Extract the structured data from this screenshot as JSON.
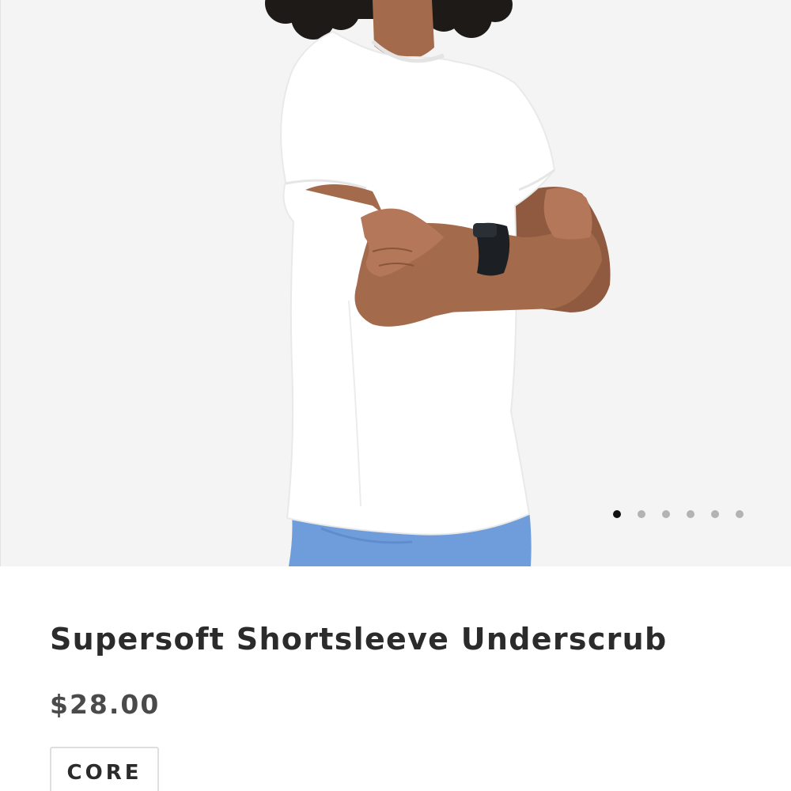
{
  "product": {
    "title": "Supersoft Shortsleeve Underscrub",
    "price": "$28.00",
    "tag": "CORE"
  },
  "gallery": {
    "image_count": 6,
    "active_index": 0
  },
  "colors": {
    "background": "#f4f4f4",
    "shirt": "#ffffff",
    "pants": "#6f9ddc",
    "skin": "#a36a4c",
    "hair": "#1e1a17",
    "watch": "#1c1f24",
    "dot_active": "#111111",
    "dot_inactive": "#b3b3b3",
    "text": "#2b2b2b"
  }
}
